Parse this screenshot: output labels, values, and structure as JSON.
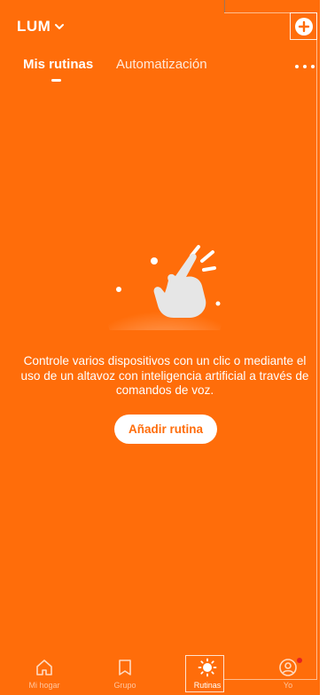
{
  "header": {
    "home_name": "LUM"
  },
  "tabs": [
    {
      "label": "Mis rutinas",
      "active": true
    },
    {
      "label": "Automatización",
      "active": false
    }
  ],
  "empty_state": {
    "description": "Controle varios dispositivos con un clic o mediante el uso de un altavoz con inteligencia artificial a través de comandos de voz.",
    "button_label": "Añadir rutina"
  },
  "bottom_nav": [
    {
      "label": "Mi hogar",
      "icon": "house-icon",
      "active": false
    },
    {
      "label": "Grupo",
      "icon": "bookmark-icon",
      "active": false
    },
    {
      "label": "Rutinas",
      "icon": "sun-icon",
      "active": true
    },
    {
      "label": "Yo",
      "icon": "user-icon",
      "active": false,
      "has_badge": true
    }
  ],
  "colors": {
    "background": "#ff6d0a",
    "accent_text": "#ff6d0a",
    "badge": "#e52222"
  }
}
